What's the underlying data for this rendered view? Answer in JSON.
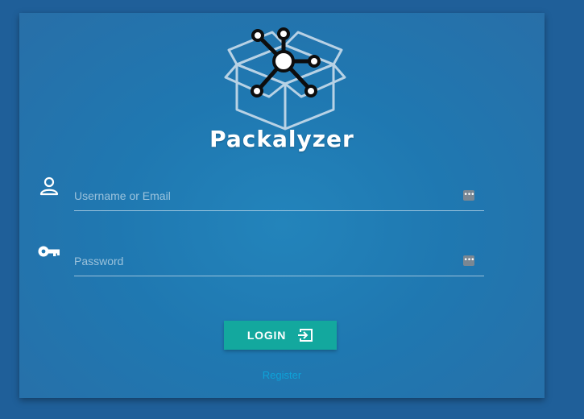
{
  "app": {
    "name": "Packalyzer"
  },
  "form": {
    "username": {
      "placeholder": "Username or Email",
      "value": ""
    },
    "password": {
      "placeholder": "Password",
      "value": ""
    },
    "login_label": "LOGIN",
    "register_label": "Register"
  },
  "icons": {
    "user": "person-icon",
    "password": "key-icon",
    "login": "login-arrow-icon",
    "field_autofill": "password-manager-icon",
    "logo": "box-network-icon"
  },
  "colors": {
    "page_background": "#1f5f99",
    "card_background": "#1f78b1",
    "login_button": "#13a89e",
    "register_link": "#0ea2d8"
  }
}
